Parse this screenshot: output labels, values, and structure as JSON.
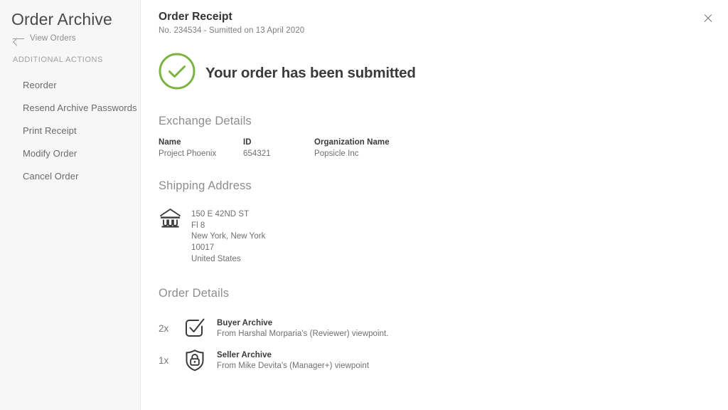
{
  "sidebar": {
    "title": "Order Archive",
    "back_link": {
      "label": "View Orders",
      "icon": "arrow-left-icon"
    },
    "section_caption": "ADDITIONAL ACTIONS",
    "items": [
      {
        "label": "Reorder"
      },
      {
        "label": "Resend Archive Passwords"
      },
      {
        "label": "Print Receipt"
      },
      {
        "label": "Modify Order"
      },
      {
        "label": "Cancel Order"
      }
    ]
  },
  "main": {
    "title": "Order Receipt",
    "subtitle": "No. 234534 - Sumitted on 13 April 2020",
    "close_icon": "close-icon",
    "success": {
      "icon": "check-circle-icon",
      "message": "Your order has been submitted",
      "color": "#7cb342"
    },
    "exchange_details": {
      "heading": "Exchange Details",
      "fields": [
        {
          "label": "Name",
          "value": "Project Phoenix"
        },
        {
          "label": "ID",
          "value": "654321"
        },
        {
          "label": "Organization Name",
          "value": "Popsicle Inc"
        }
      ]
    },
    "shipping_address": {
      "heading": "Shipping Address",
      "icon": "bank-building-icon",
      "lines": [
        "150 E 42ND ST",
        "Fl 8",
        "New York, New York",
        "10017",
        "United States"
      ]
    },
    "order_details": {
      "heading": "Order Details",
      "items": [
        {
          "quantity": "2x",
          "icon": "checkbox-check-icon",
          "name": "Buyer Archive",
          "description": "From Harshal Morparia's (Reviewer) viewpoint."
        },
        {
          "quantity": "1x",
          "icon": "shield-lock-icon",
          "name": "Seller Archive",
          "description": "From Mike Devita's (Manager+) viewpoint"
        }
      ]
    }
  },
  "colors": {
    "accent_green": "#7cb342",
    "sidebar_bg": "#f7f7f7",
    "text_dark": "#3a3a3a",
    "text_muted": "#6f6f6f"
  }
}
